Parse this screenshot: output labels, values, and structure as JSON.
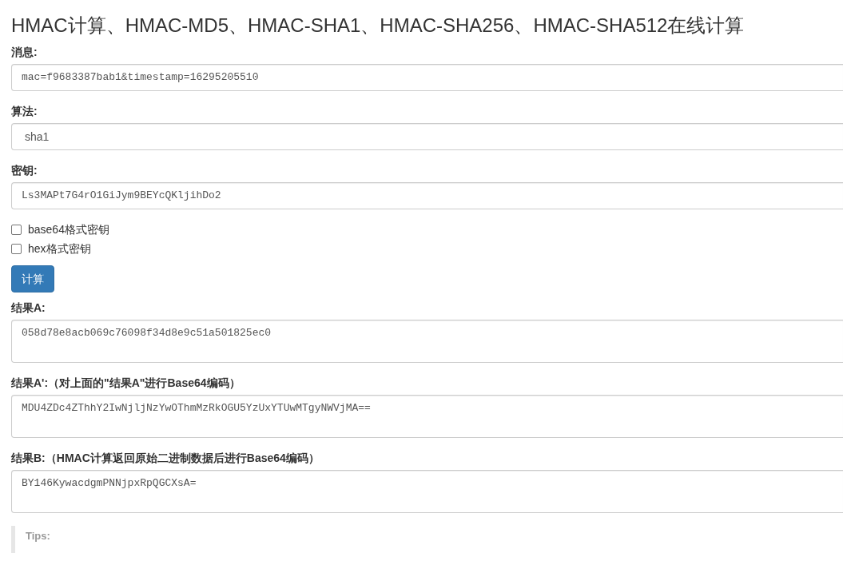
{
  "title": "HMAC计算、HMAC-MD5、HMAC-SHA1、HMAC-SHA256、HMAC-SHA512在线计算",
  "fields": [
    {
      "kind": "input",
      "label": "消息:",
      "value": "mac=f9683387bab1&timestamp=16295205510"
    },
    {
      "kind": "select",
      "label": "算法:",
      "value": "sha1"
    },
    {
      "kind": "input",
      "label": "密钥:",
      "value": "Ls3MAPt7G4rO1GiJym9BEYcQKljihDo2"
    }
  ],
  "options": [
    {
      "label": "base64格式密钥",
      "checked": false
    },
    {
      "label": "hex格式密钥",
      "checked": false
    }
  ],
  "button": "计算",
  "results": [
    {
      "label": "结果A:",
      "value": "058d78e8acb069c76098f34d8e9c51a501825ec0"
    },
    {
      "label": "结果A':（对上面的\"结果A\"进行Base64编码）",
      "value": "MDU4ZDc4ZThhY2IwNjljNzYwOThmMzRkOGU5YzUxYTUwMTgyNWVjMA=="
    },
    {
      "label": "结果B:（HMAC计算返回原始二进制数据后进行Base64编码）",
      "value": "BY146KywacdgmPNNjpxRpQGCXsA="
    }
  ],
  "tips": {
    "heading": "Tips:"
  }
}
